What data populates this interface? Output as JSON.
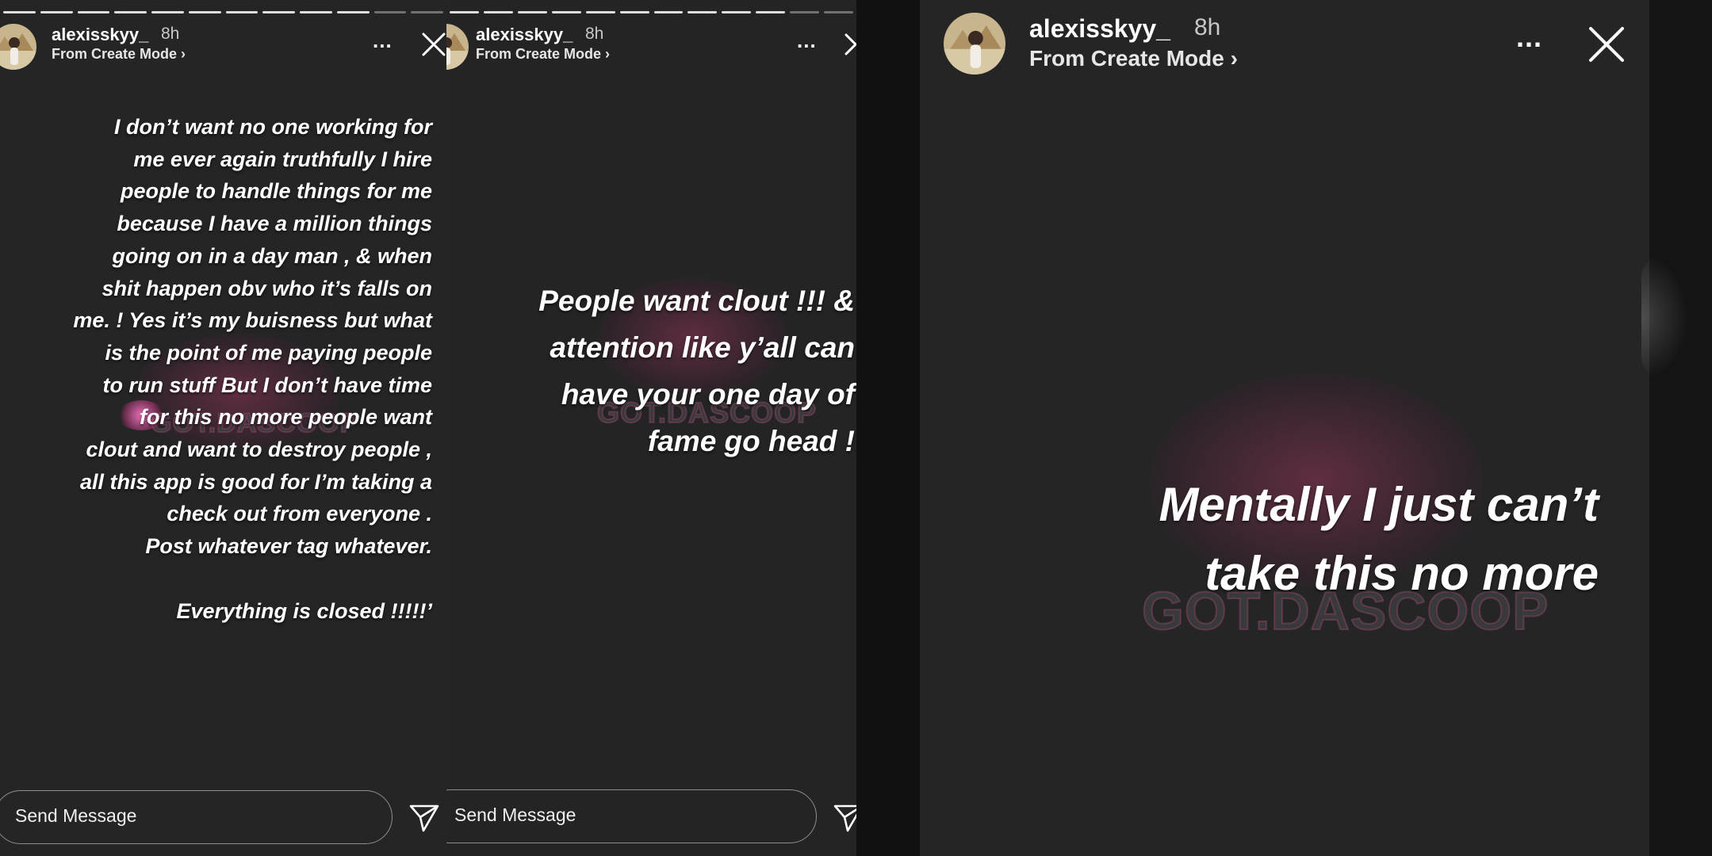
{
  "story": {
    "username": "alexisskyy_",
    "time": "8h",
    "subtitle": "From Create Mode ›",
    "more_label": "...",
    "send_placeholder": "Send Message"
  },
  "panel1": {
    "lines": [
      "I don’t want no one working for",
      "me ever again truthfully I hire",
      "people to handle things for me",
      "because I have a million things",
      "going on in a day man , & when",
      "shit happen obv who it’s falls on",
      "me. ! Yes it’s my buisness but what",
      "is the point of me paying people",
      "to run stuff But I don’t have time",
      "for this       no more people want",
      "clout and want to destroy people ,",
      "all this app is good for I’m taking a",
      "check out from everyone .",
      "Post whatever tag whatever.",
      "",
      "Everything is closed !!!!!’"
    ]
  },
  "panel2": {
    "lines": [
      "People want clout !!! &",
      "attention like y’all can",
      "have your one day of",
      "fame go head !"
    ]
  },
  "panel3": {
    "lines": [
      "Mentally I just can’t",
      "take  this no more"
    ]
  },
  "watermark": "GOT.DASCOOP"
}
